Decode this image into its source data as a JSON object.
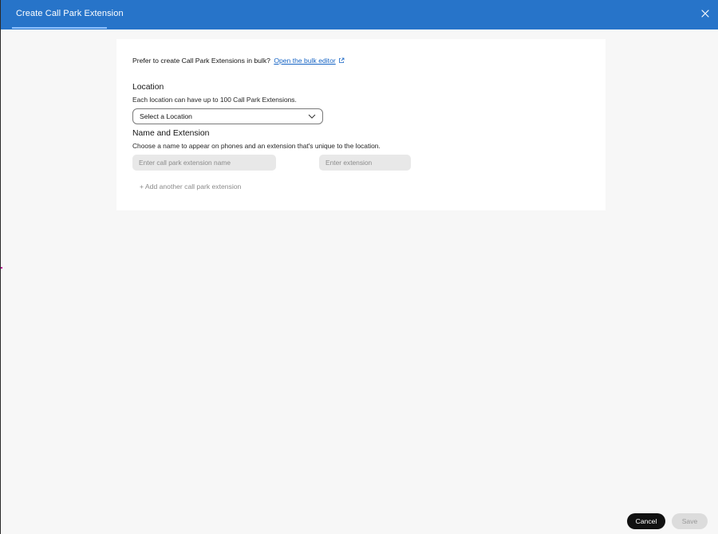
{
  "header": {
    "title": "Create Call Park Extension"
  },
  "bulk": {
    "prompt": "Prefer to create Call Park Extensions in bulk?",
    "link_label": "Open the bulk editor"
  },
  "location": {
    "title": "Location",
    "description": "Each location can have up to 100 Call Park Extensions.",
    "select_value": "Select a Location"
  },
  "name_extension": {
    "title": "Name and Extension",
    "description": "Choose a name to appear on phones and an extension that's unique to the location.",
    "name_placeholder": "Enter call park extension name",
    "extension_placeholder": "Enter extension",
    "add_label": "+ Add another call park extension"
  },
  "footer": {
    "cancel_label": "Cancel",
    "save_label": "Save"
  },
  "colors": {
    "header_bg": "#2774c9",
    "link": "#1563c4",
    "primary_button": "#111111",
    "disabled_button": "#dcdcdc"
  }
}
